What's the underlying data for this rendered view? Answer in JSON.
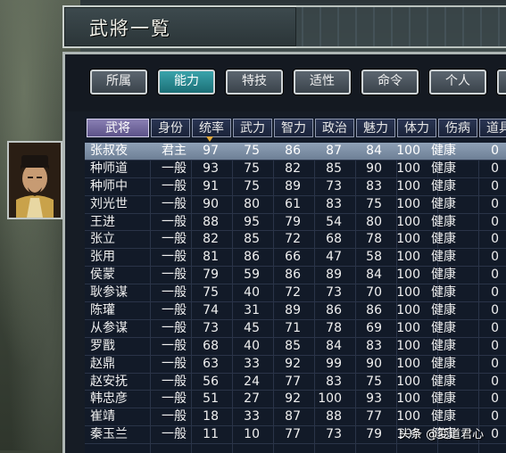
{
  "window": {
    "title": "武將一覧"
  },
  "tabs": [
    {
      "label": "所属",
      "active": false
    },
    {
      "label": "能力",
      "active": true
    },
    {
      "label": "特技",
      "active": false
    },
    {
      "label": "适性",
      "active": false
    },
    {
      "label": "命令",
      "active": false
    },
    {
      "label": "个人",
      "active": false
    },
    {
      "label": "",
      "active": false
    }
  ],
  "table": {
    "headers": [
      "武将",
      "身份",
      "统率",
      "武力",
      "智力",
      "政治",
      "魅力",
      "体力",
      "伤病",
      "道具"
    ],
    "sorted_by": "统率",
    "rows": [
      {
        "name": "张叔夜",
        "rank": "君主",
        "lead": "97",
        "war": "75",
        "int": "86",
        "pol": "87",
        "cha": "84",
        "sta": "100",
        "hp": "健康",
        "item": "0",
        "selected": true
      },
      {
        "name": "种师道",
        "rank": "一般",
        "lead": "93",
        "war": "75",
        "int": "82",
        "pol": "85",
        "cha": "90",
        "sta": "100",
        "hp": "健康",
        "item": "0"
      },
      {
        "name": "种师中",
        "rank": "一般",
        "lead": "91",
        "war": "75",
        "int": "89",
        "pol": "73",
        "cha": "83",
        "sta": "100",
        "hp": "健康",
        "item": "0"
      },
      {
        "name": "刘光世",
        "rank": "一般",
        "lead": "90",
        "war": "80",
        "int": "61",
        "pol": "83",
        "cha": "75",
        "sta": "100",
        "hp": "健康",
        "item": "0"
      },
      {
        "name": "王进",
        "rank": "一般",
        "lead": "88",
        "war": "95",
        "int": "79",
        "pol": "54",
        "cha": "80",
        "sta": "100",
        "hp": "健康",
        "item": "0"
      },
      {
        "name": "张立",
        "rank": "一般",
        "lead": "82",
        "war": "85",
        "int": "72",
        "pol": "68",
        "cha": "78",
        "sta": "100",
        "hp": "健康",
        "item": "0"
      },
      {
        "name": "张用",
        "rank": "一般",
        "lead": "81",
        "war": "86",
        "int": "66",
        "pol": "47",
        "cha": "58",
        "sta": "100",
        "hp": "健康",
        "item": "0"
      },
      {
        "name": "侯蒙",
        "rank": "一般",
        "lead": "79",
        "war": "59",
        "int": "86",
        "pol": "89",
        "cha": "84",
        "sta": "100",
        "hp": "健康",
        "item": "0"
      },
      {
        "name": "耿参谋",
        "rank": "一般",
        "lead": "75",
        "war": "40",
        "int": "72",
        "pol": "73",
        "cha": "70",
        "sta": "100",
        "hp": "健康",
        "item": "0"
      },
      {
        "name": "陈瓘",
        "rank": "一般",
        "lead": "74",
        "war": "31",
        "int": "89",
        "pol": "86",
        "cha": "86",
        "sta": "100",
        "hp": "健康",
        "item": "0"
      },
      {
        "name": "从参谋",
        "rank": "一般",
        "lead": "73",
        "war": "45",
        "int": "71",
        "pol": "78",
        "cha": "69",
        "sta": "100",
        "hp": "健康",
        "item": "0"
      },
      {
        "name": "罗戬",
        "rank": "一般",
        "lead": "68",
        "war": "40",
        "int": "85",
        "pol": "84",
        "cha": "83",
        "sta": "100",
        "hp": "健康",
        "item": "0"
      },
      {
        "name": "赵鼎",
        "rank": "一般",
        "lead": "63",
        "war": "33",
        "int": "92",
        "pol": "99",
        "cha": "90",
        "sta": "100",
        "hp": "健康",
        "item": "0"
      },
      {
        "name": "赵安抚",
        "rank": "一般",
        "lead": "56",
        "war": "24",
        "int": "77",
        "pol": "83",
        "cha": "75",
        "sta": "100",
        "hp": "健康",
        "item": "0"
      },
      {
        "name": "韩忠彦",
        "rank": "一般",
        "lead": "51",
        "war": "27",
        "int": "92",
        "pol": "100",
        "cha": "93",
        "sta": "100",
        "hp": "健康",
        "item": "0"
      },
      {
        "name": "崔靖",
        "rank": "一般",
        "lead": "18",
        "war": "33",
        "int": "87",
        "pol": "88",
        "cha": "77",
        "sta": "100",
        "hp": "健康",
        "item": "0"
      },
      {
        "name": "秦玉兰",
        "rank": "一般",
        "lead": "11",
        "war": "10",
        "int": "77",
        "pol": "73",
        "cha": "79",
        "sta": "100",
        "hp": "健康",
        "item": "0"
      }
    ]
  },
  "watermark": "头条 @変道君心",
  "colors": {
    "tab_active": "#1c6f76",
    "header_selected": "#5c5288",
    "row_selected": "#8ea0b6"
  }
}
